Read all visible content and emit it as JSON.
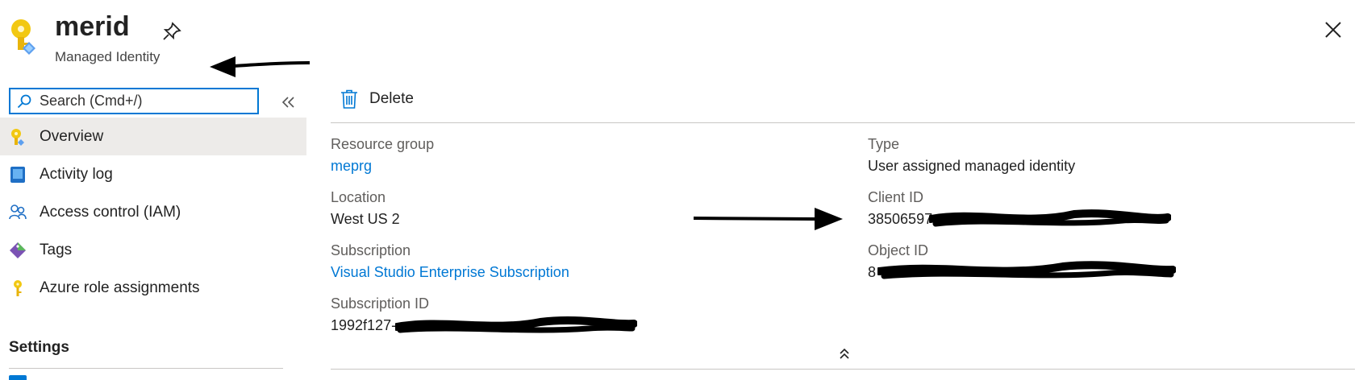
{
  "header": {
    "title": "merid",
    "subtitle": "Managed Identity",
    "app_icon": "managed-identity-key-icon",
    "pin_icon": "pin-icon",
    "close_icon": "close-icon"
  },
  "sidebar": {
    "search_placeholder": "Search (Cmd+/)",
    "collapse_icon": "double-chevron-left-icon",
    "items": [
      {
        "label": "Overview",
        "icon": "overview-key-icon",
        "selected": true
      },
      {
        "label": "Activity log",
        "icon": "activity-log-icon",
        "selected": false
      },
      {
        "label": "Access control (IAM)",
        "icon": "people-icon",
        "selected": false
      },
      {
        "label": "Tags",
        "icon": "tag-icon",
        "selected": false
      },
      {
        "label": "Azure role assignments",
        "icon": "key-icon",
        "selected": false
      }
    ],
    "section_heading": "Settings"
  },
  "toolbar": {
    "delete_label": "Delete",
    "delete_icon": "trash-icon"
  },
  "essentials": {
    "left": {
      "resource_group_label": "Resource group",
      "resource_group_value": "meprg",
      "location_label": "Location",
      "location_value": "West US 2",
      "subscription_label": "Subscription",
      "subscription_value": "Visual Studio Enterprise Subscription",
      "subscription_id_label": "Subscription ID",
      "subscription_id_value": "1992f127-"
    },
    "right": {
      "type_label": "Type",
      "type_value": "User assigned managed identity",
      "client_id_label": "Client ID",
      "client_id_value": "38506597",
      "object_id_label": "Object ID",
      "object_id_value": "8"
    },
    "expand_icon": "double-chevron-up-icon"
  },
  "colors": {
    "accent": "#0078d4",
    "selected_bg": "#edebe9",
    "divider": "#c8c6c4"
  }
}
